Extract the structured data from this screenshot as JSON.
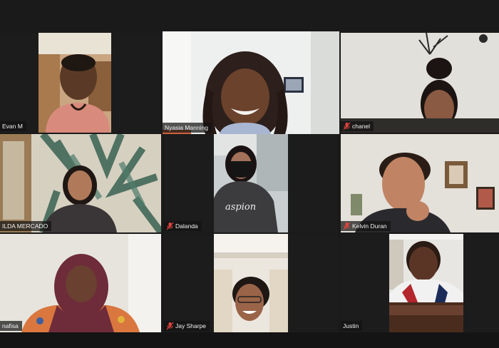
{
  "colors": {
    "active_speaker_border": "#c5e86c",
    "mute_icon": "#e0443e",
    "background": "#1a1a1a"
  },
  "participants": [
    {
      "name": "Evan M",
      "muted": false,
      "active": false
    },
    {
      "name": "Nyasia Manning",
      "muted": false,
      "active": true
    },
    {
      "name": "chanel",
      "muted": true,
      "active": false
    },
    {
      "name": "ILDA MERCADO",
      "muted": false,
      "active": false
    },
    {
      "name": "Dalanda",
      "muted": true,
      "active": false
    },
    {
      "name": "Kelvin Duran",
      "muted": true,
      "active": false
    },
    {
      "name": "nafisa",
      "muted": false,
      "active": false
    },
    {
      "name": "Jay Sharpe",
      "muted": true,
      "active": false
    },
    {
      "name": "Justin",
      "muted": false,
      "active": false
    }
  ],
  "shirt_text": "aspion"
}
